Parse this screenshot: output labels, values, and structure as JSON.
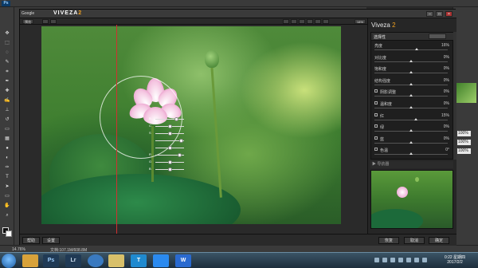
{
  "ps": {
    "logo": "Ps",
    "zoom": "14.76%",
    "doc_info": "文档:107.1M/608.8M"
  },
  "viveza": {
    "google": "Google",
    "title": "VIVEZA",
    "version": "2",
    "toolbar": {
      "left_btn": "预览",
      "right_label": "14%"
    },
    "controlpoint_labels": [
      "B",
      "C",
      "S",
      "",
      "",
      "R",
      "G",
      "B"
    ],
    "panel": {
      "title_main": "Viveza",
      "title_version": "2",
      "section_title": "选择性",
      "sliders": [
        {
          "label": "亮度",
          "value": "16%",
          "level": 0.58
        },
        {
          "label": "对比度",
          "value": "0%",
          "level": 0.5
        },
        {
          "label": "饱和度",
          "value": "0%",
          "level": 0.5
        },
        {
          "label": "结构强度",
          "value": "0%",
          "level": 0.5
        },
        {
          "label": "阴影调整",
          "value": "0%",
          "level": 0.5,
          "check": true
        },
        {
          "label": "温和度",
          "value": "0%",
          "level": 0.5,
          "check": true
        },
        {
          "label": "红",
          "value": "15%",
          "level": 0.57,
          "check": true
        },
        {
          "label": "绿",
          "value": "0%",
          "level": 0.5,
          "check": true
        },
        {
          "label": "蓝",
          "value": "0%",
          "level": 0.5,
          "check": true
        },
        {
          "label": "色温",
          "value": "0°",
          "level": 0.5,
          "check": true
        }
      ],
      "preview_header": "▶ 导航器"
    },
    "bottom": {
      "help": "帮助",
      "settings": "设置",
      "reset": "恢复",
      "cancel": "取消",
      "ok": "确定"
    }
  },
  "right_fields": [
    "100%",
    "100%",
    "100%"
  ],
  "taskbar": {
    "apps": [
      "",
      "",
      "Ps",
      "Lr",
      "",
      "",
      "T",
      "",
      ""
    ],
    "time": "0:22 星期四",
    "date": "2017/2/2"
  },
  "colors": {
    "ps_blue": "#0b3a66",
    "viveza_orange": "#f0a020",
    "guide_red": "#d03030"
  }
}
